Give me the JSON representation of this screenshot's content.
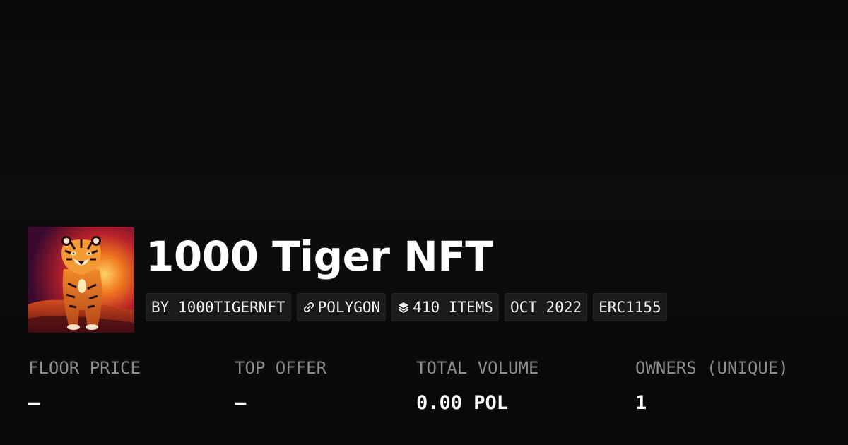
{
  "collection": {
    "title": "1000 Tiger NFT",
    "avatar_icon": "tiger-avatar",
    "badges": {
      "creator": "BY 1000TIGERNFT",
      "chain": "POLYGON",
      "chain_icon": "polygon-link-icon",
      "items": "410 ITEMS",
      "items_icon": "layers-icon",
      "date": "OCT 2022",
      "standard": "ERC1155"
    }
  },
  "stats": {
    "floor_price": {
      "label": "FLOOR PRICE",
      "value": "–"
    },
    "top_offer": {
      "label": "TOP OFFER",
      "value": "–"
    },
    "total_volume": {
      "label": "TOTAL VOLUME",
      "value": "0.00 POL"
    },
    "owners": {
      "label": "OWNERS (UNIQUE)",
      "value": "1"
    }
  },
  "colors": {
    "background": "#0b0b0b",
    "badge_background": "#1b1b1b",
    "label": "#8e8e8e",
    "text": "#ffffff"
  }
}
